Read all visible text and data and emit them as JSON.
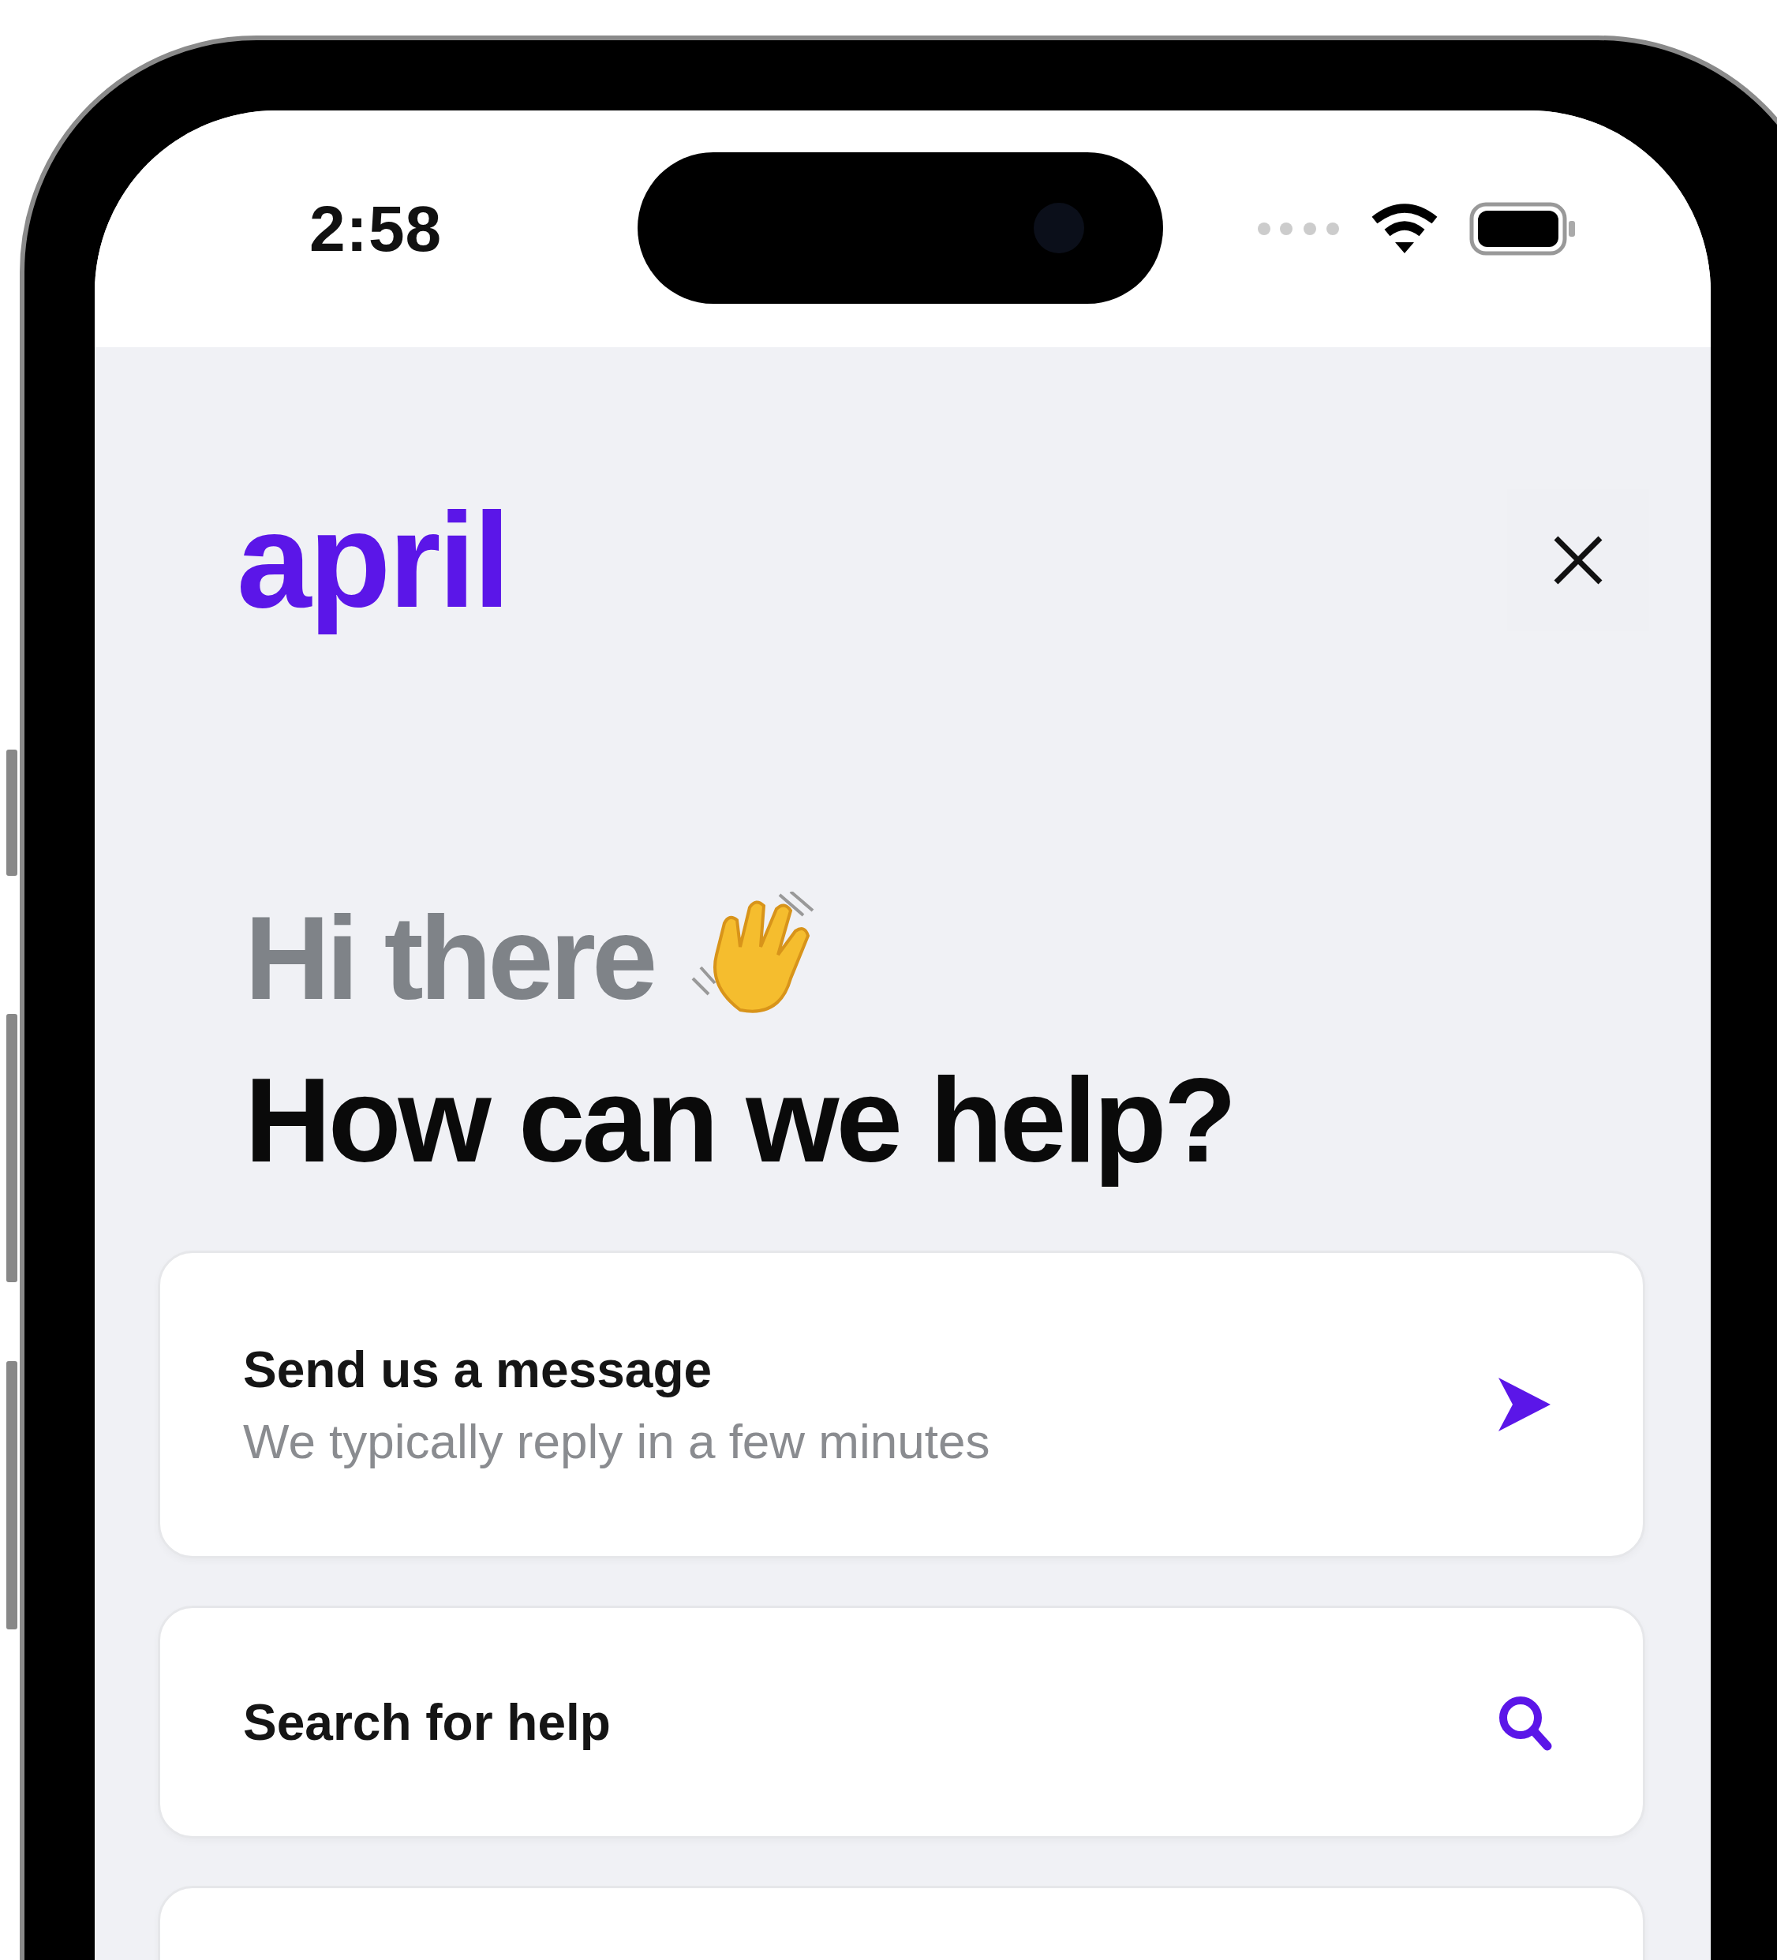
{
  "status_bar": {
    "time": "2:58"
  },
  "header": {
    "logo": "april"
  },
  "greeting": {
    "line_1": "Hi there",
    "line_2": "How can we help?"
  },
  "cards": [
    {
      "kind": "message",
      "title": "Send us a message",
      "subtitle": "We typically reply in a few minutes"
    },
    {
      "kind": "search",
      "title": "Search for help"
    },
    {
      "kind": "empty"
    }
  ]
}
